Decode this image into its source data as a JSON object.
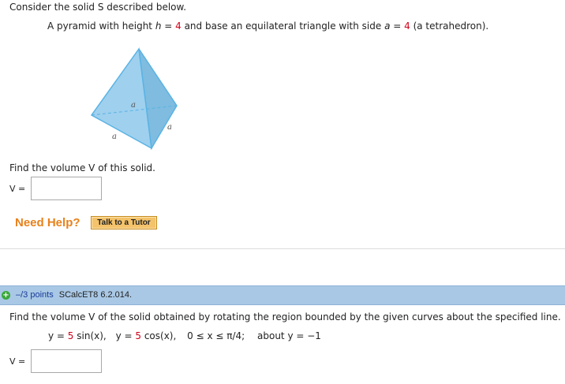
{
  "problem1": {
    "intro": "Consider the solid S described below.",
    "desc_part1": "A pyramid with height ",
    "h_var": "h",
    "eq1": " = ",
    "h_value": "4",
    "desc_part2": " and base an equilateral triangle with side ",
    "a_var": "a",
    "eq2": " = ",
    "a_value": "4",
    "desc_part3": " (a tetrahedron).",
    "figure_labels": [
      "a",
      "a",
      "a"
    ],
    "find_text": "Find the volume V of this solid.",
    "answer_label": "V =",
    "answer_value": ""
  },
  "help": {
    "need_help": "Need Help?",
    "tutor_button": "Talk to a Tutor"
  },
  "problem2": {
    "points": "–/3 points",
    "code": "SCalcET8 6.2.014.",
    "question": "Find the volume V of the solid obtained by rotating the region bounded by the given curves about the specified line.",
    "y1_lhs": "y = ",
    "y1_coef": "5",
    "y1_func": " sin(x),",
    "y2_lhs": "y = ",
    "y2_coef": "5",
    "y2_func": " cos(x),",
    "range": "0 ≤ x ≤ π/4;",
    "about_text": "about y = −1",
    "answer_label": "V =",
    "answer_value": ""
  },
  "colors": {
    "accent_red": "#d0021b",
    "help_orange": "#e8811a",
    "bar_blue": "#a9c8e5"
  }
}
